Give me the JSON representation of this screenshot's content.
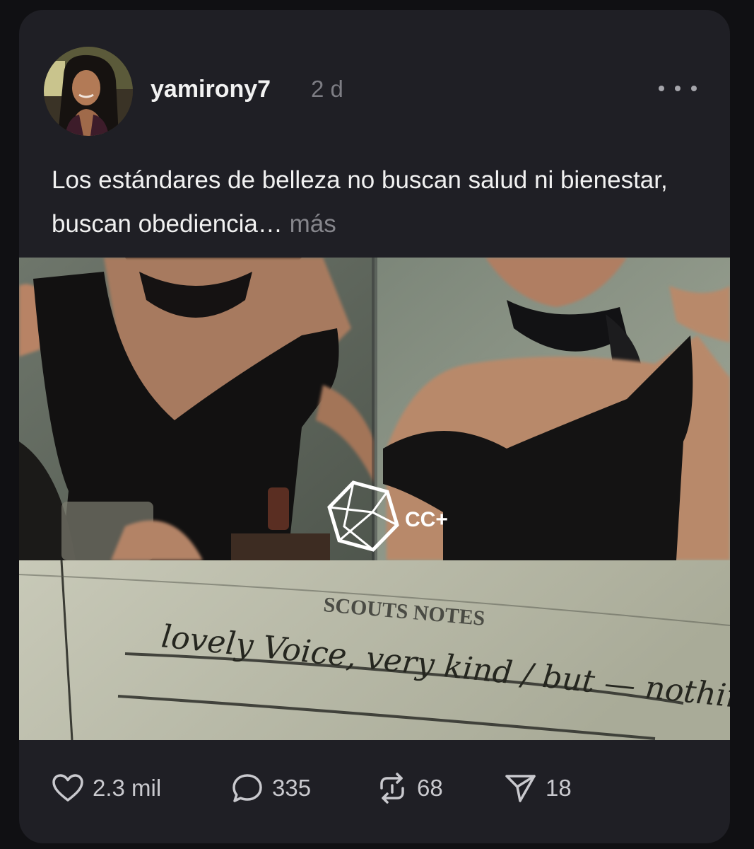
{
  "post": {
    "username": "yamirony7",
    "time": "2 d",
    "text": "Los estándares de belleza no buscan salud ni bienestar, buscan obediencia…",
    "more_label": "más"
  },
  "media": {
    "watermark": "CC+",
    "note_heading": "SCOUTS NOTES",
    "note_handwriting": "lovely Voice, very kind / but — nothing special / Boring"
  },
  "actions": {
    "likes": "2.3 mil",
    "comments": "335",
    "reposts": "68",
    "shares": "18"
  },
  "colors": {
    "background": "#101013",
    "card": "#1f1f25",
    "text": "#f1f1f1",
    "muted": "#86868c"
  }
}
